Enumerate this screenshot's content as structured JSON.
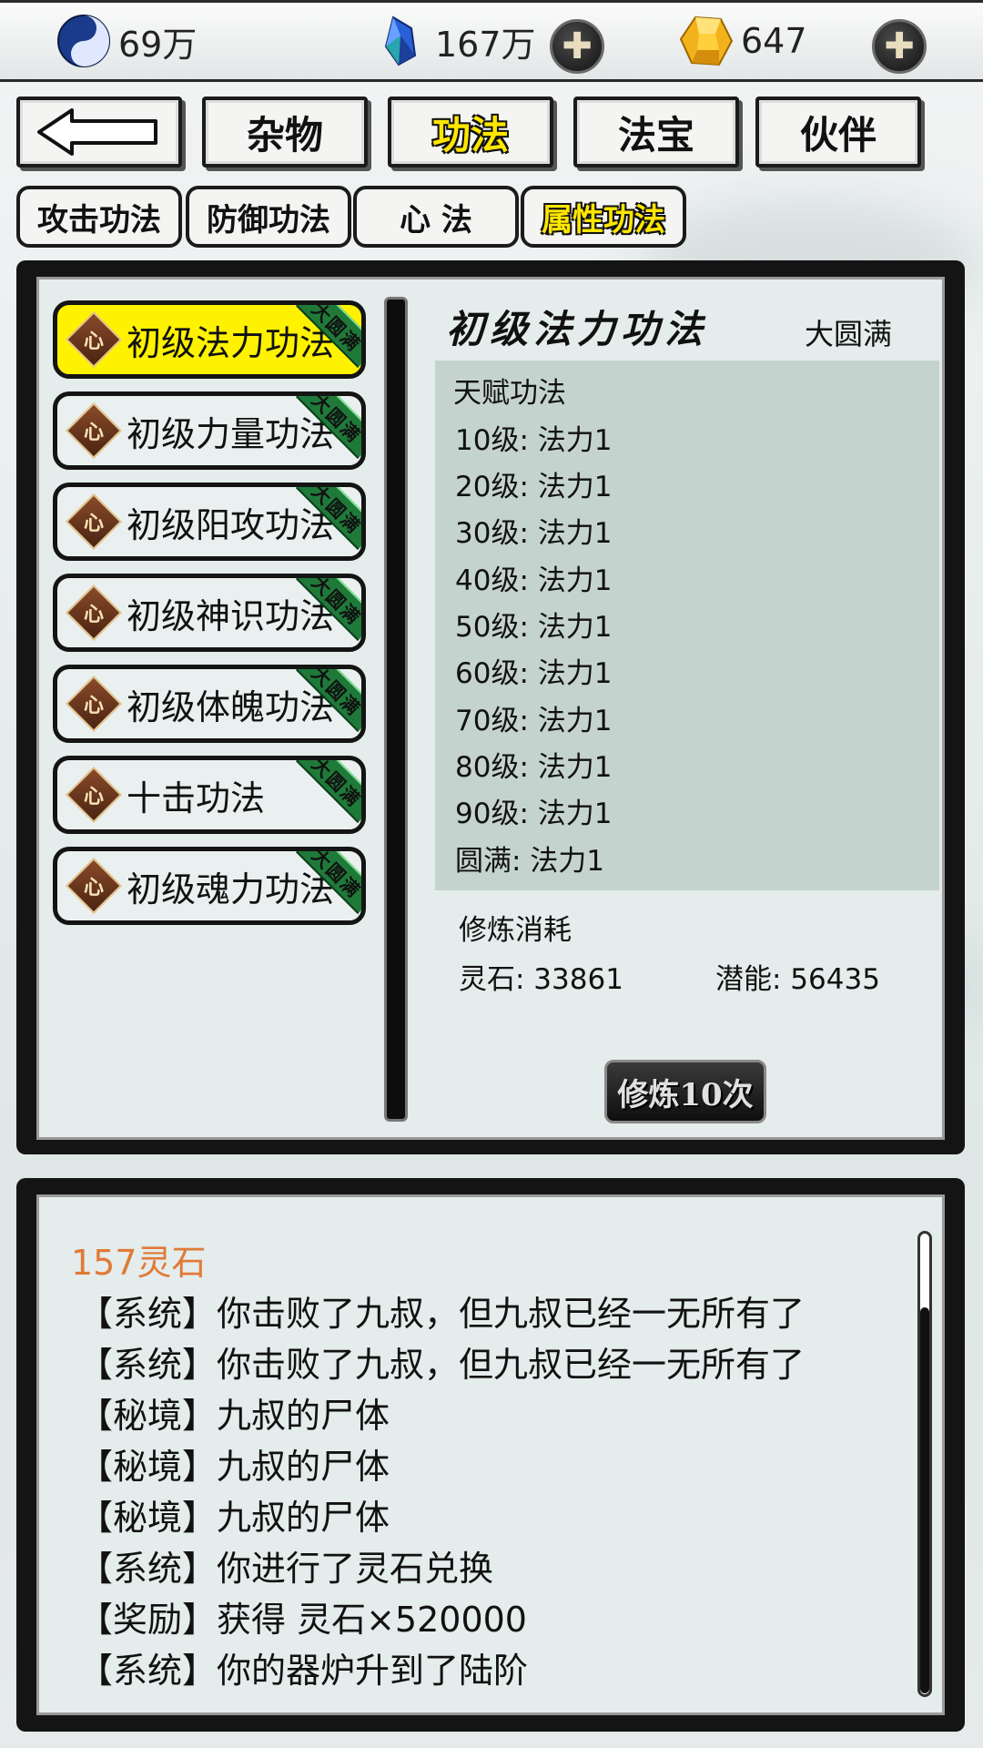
{
  "resources": {
    "yinyang": {
      "icon": "yin-yang-icon",
      "value": "69万"
    },
    "crystal": {
      "icon": "blue-crystal-icon",
      "value": "167万"
    },
    "gold": {
      "icon": "gold-gem-icon",
      "value": "647"
    },
    "plus_symbol": "✚"
  },
  "back_button": {
    "icon": "back-arrow-icon"
  },
  "main_tabs": [
    {
      "label": "杂物"
    },
    {
      "label": "功法"
    },
    {
      "label": "法宝"
    },
    {
      "label": "伙伴"
    }
  ],
  "sub_tabs": [
    {
      "label": "攻击功法"
    },
    {
      "label": "防御功法"
    },
    {
      "label": "心 法"
    },
    {
      "label": "属性功法"
    }
  ],
  "skill_badge": "心",
  "skill_ribbon": "大圆满",
  "skills": [
    {
      "name": "初级法力功法"
    },
    {
      "name": "初级力量功法"
    },
    {
      "name": "初级阳攻功法"
    },
    {
      "name": "初级神识功法"
    },
    {
      "name": "初级体魄功法"
    },
    {
      "name": "十击功法"
    },
    {
      "name": "初级魂力功法"
    }
  ],
  "detail": {
    "title": "初级法力功法",
    "status": "大圆满",
    "effects": [
      "天赋功法",
      "10级: 法力1",
      "20级: 法力1",
      "30级: 法力1",
      "40级: 法力1",
      "50级: 法力1",
      "60级: 法力1",
      "70级: 法力1",
      "80级: 法力1",
      "90级: 法力1",
      "圆满: 法力1"
    ],
    "cost_label": "修炼消耗",
    "spirit_stone": "灵石: 33861",
    "potential": "潜能: 56435",
    "train_button": "修炼10次"
  },
  "log": {
    "reward": "157灵石",
    "lines": [
      "【系统】你击败了九叔，但九叔已经一无所有了",
      "【系统】你击败了九叔，但九叔已经一无所有了",
      "【秘境】九叔的尸体",
      "【秘境】九叔的尸体",
      "【秘境】九叔的尸体",
      "【系统】你进行了灵石兑换",
      "【奖励】获得 灵石×520000",
      "【系统】你的器炉升到了陆阶"
    ]
  }
}
